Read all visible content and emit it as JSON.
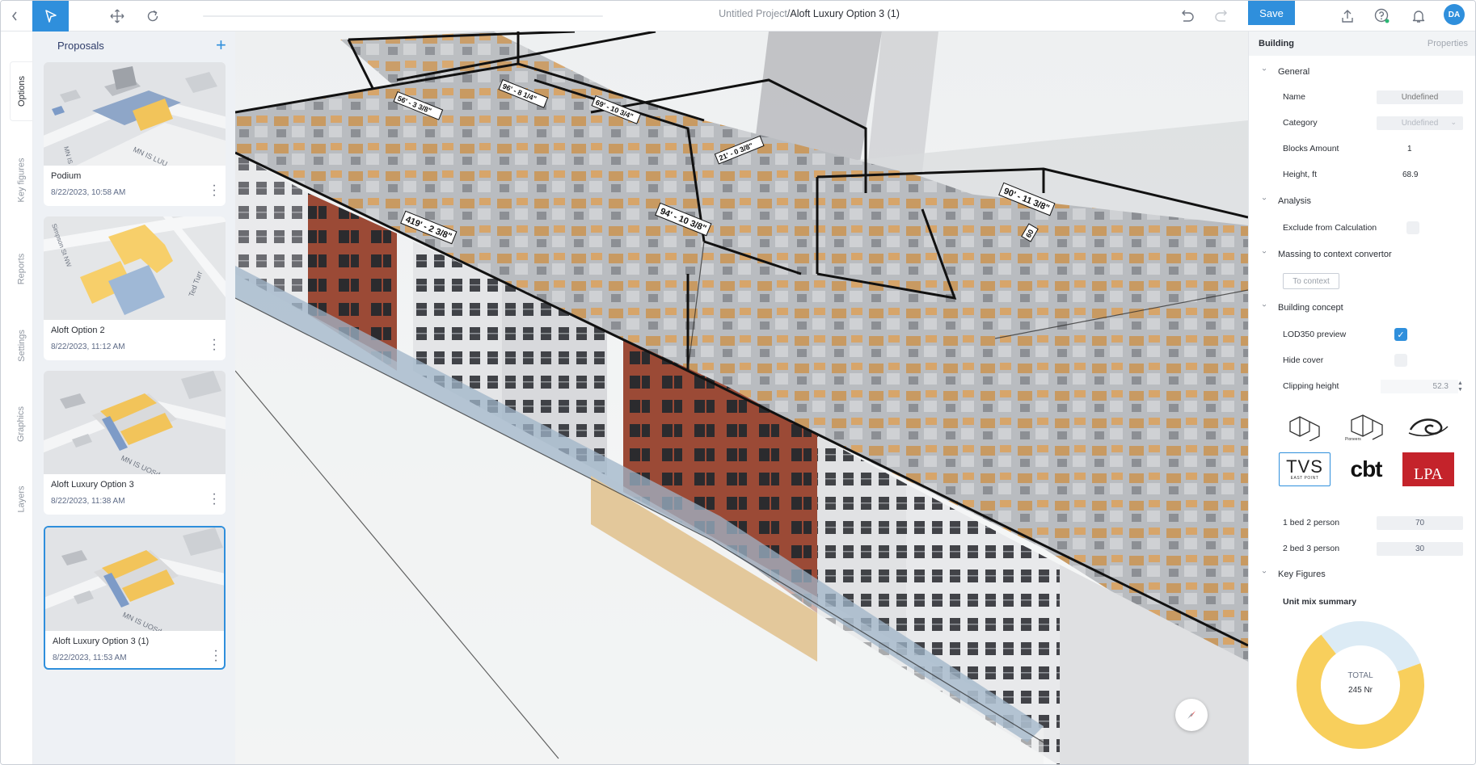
{
  "toolbar": {
    "project_name": "Untitled Project",
    "separator": "/",
    "option_name": "Aloft Luxury Option 3 (1)",
    "save_label": "Save",
    "avatar_initials": "DA",
    "accent_color": "#2f8fdc",
    "icons": [
      "chevron-left-icon",
      "select-cursor-icon",
      "move-icon",
      "rotate-icon",
      "undo-icon",
      "redo-icon",
      "upload-icon",
      "help-icon",
      "bell-icon"
    ]
  },
  "sidebar_tabs": [
    "Options",
    "Key figures",
    "Reports",
    "Settings",
    "Graphics",
    "Layers"
  ],
  "proposals": {
    "title": "Proposals",
    "add_icon": "plus-icon",
    "items": [
      {
        "name": "Podium",
        "date": "8/22/2023, 10:58 AM",
        "selected": false
      },
      {
        "name": "Aloft Option 2",
        "date": "8/22/2023, 11:12 AM",
        "selected": false
      },
      {
        "name": "Aloft Luxury Option 3",
        "date": "8/22/2023, 11:38 AM",
        "selected": false
      },
      {
        "name": "Aloft Luxury Option 3 (1)",
        "date": "8/22/2023, 11:53 AM",
        "selected": true
      }
    ],
    "map_labels": {
      "street_1": "MN IS LUU",
      "street_2": "MN IS LUU",
      "simpson": "Simpson St NW",
      "ted_turner": "Ted Turr",
      "street_3": "MN IS UOSd",
      "street_4": "MN IS UOSd"
    }
  },
  "viewport": {
    "dimension_labels": [
      "419' - 2 3/8\"",
      "94' - 10 3/8\"",
      "90' - 11 3/8\"",
      "56' - 3 3/8\"",
      "96' - 8 1/4\"",
      "69' - 10 3/4\"",
      "21' - 0 3/8\"",
      "60"
    ]
  },
  "properties": {
    "tab_building": "Building",
    "tab_properties": "Properties",
    "general": {
      "title": "General",
      "name_label": "Name",
      "name_placeholder": "Undefined",
      "category_label": "Category",
      "category_value": "Undefined",
      "blocks_label": "Blocks Amount",
      "blocks_value": "1",
      "height_label": "Height, ft",
      "height_value": "68.9"
    },
    "analysis": {
      "title": "Analysis",
      "exclude_label": "Exclude from Calculation",
      "exclude_checked": false
    },
    "massing": {
      "title": "Massing to context convertor",
      "button_label": "To context"
    },
    "concept": {
      "title": "Building concept",
      "lod_label": "LOD350 preview",
      "lod_checked": true,
      "hide_label": "Hide cover",
      "hide_checked": false,
      "clip_label": "Clipping height",
      "clip_value": "52.3",
      "logos": [
        "blocks-outline-logo",
        "pioneers-logo",
        "swirl-logo",
        "tvs-logo",
        "cbt-logo",
        "lpa-logo"
      ],
      "pioneers_text": "Pioneers",
      "tvs_text": "TVS",
      "tvs_sub": "EAST POINT",
      "cbt_text": "cbt",
      "lpa_text": "LPA",
      "unit1_label": "1 bed 2 person",
      "unit1_value": "70",
      "unit2_label": "2 bed 3 person",
      "unit2_value": "30"
    },
    "key_figures": {
      "title": "Key Figures",
      "summary_label": "Unit mix summary",
      "total_label": "TOTAL",
      "total_value": "245 Nr",
      "segment_colors": [
        "#f8cf5c",
        "#dcebf5"
      ],
      "segments_percent": [
        70,
        30
      ]
    }
  }
}
